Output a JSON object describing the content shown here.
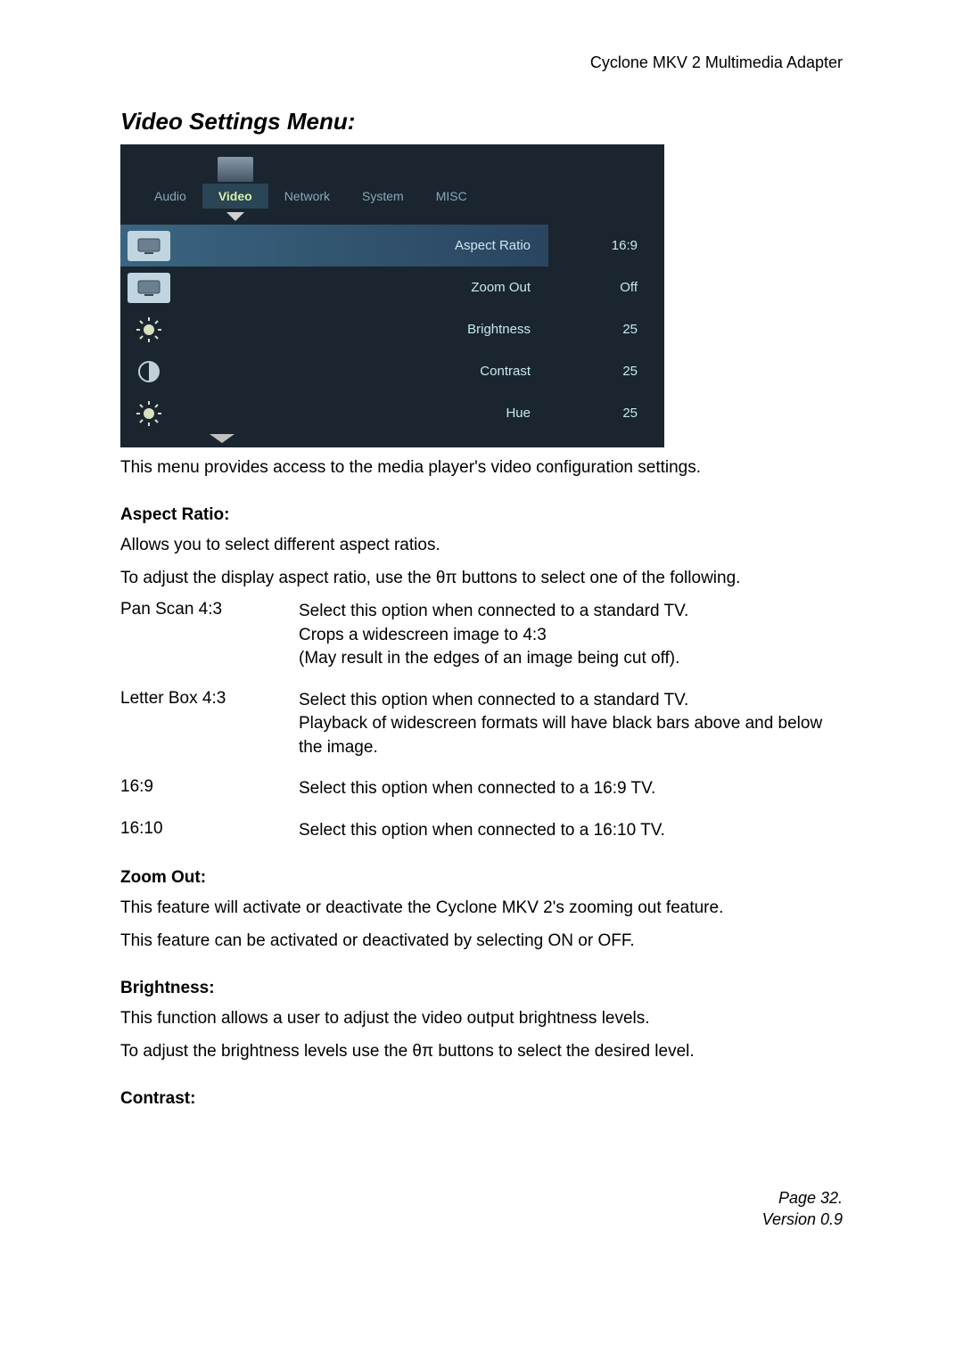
{
  "header": {
    "product": "Cyclone MKV 2 Multimedia Adapter"
  },
  "section_title": "Video Settings Menu:",
  "screenshot": {
    "tabs": [
      {
        "label": "Audio",
        "active": false
      },
      {
        "label": "Video",
        "active": true
      },
      {
        "label": "Network",
        "active": false
      },
      {
        "label": "System",
        "active": false
      },
      {
        "label": "MISC",
        "active": false
      }
    ],
    "settings": [
      {
        "label": "Aspect Ratio",
        "value": "16:9",
        "icon": "screen",
        "selected": true
      },
      {
        "label": "Zoom Out",
        "value": "Off",
        "icon": "screen",
        "selected": false
      },
      {
        "label": "Brightness",
        "value": "25",
        "icon": "sun",
        "selected": false
      },
      {
        "label": "Contrast",
        "value": "25",
        "icon": "circle",
        "selected": false
      },
      {
        "label": "Hue",
        "value": "25",
        "icon": "sun",
        "selected": false
      }
    ]
  },
  "intro_text": "This menu provides access to the media player's video configuration settings.",
  "aspect_ratio": {
    "heading": "Aspect Ratio:",
    "p1": "Allows you to select different aspect ratios.",
    "p2": "To adjust the display aspect ratio, use the θπ buttons to select one of the following.",
    "options": [
      {
        "name": "Pan Scan 4:3",
        "lines": [
          "Select this option when connected to a standard TV.",
          "Crops a widescreen image to 4:3",
          "(May result in the edges of an image being cut off)."
        ]
      },
      {
        "name": "Letter Box 4:3",
        "lines": [
          "Select this option when connected to a standard TV.",
          "Playback of widescreen formats will have black bars above and below the image."
        ]
      },
      {
        "name": "16:9",
        "lines": [
          "Select this option when connected to a 16:9 TV."
        ]
      },
      {
        "name": "16:10",
        "lines": [
          "Select this option when connected to a 16:10 TV."
        ]
      }
    ]
  },
  "zoom_out": {
    "heading": "Zoom Out:",
    "p1": "This feature will activate or deactivate the Cyclone MKV 2's zooming out feature.",
    "p2": "This feature can be activated or deactivated by selecting ON or OFF."
  },
  "brightness": {
    "heading": "Brightness:",
    "p1": "This function allows a user to adjust the video output brightness levels.",
    "p2": "To adjust the brightness levels use the θπ buttons to select the desired level."
  },
  "contrast": {
    "heading": "Contrast:"
  },
  "footer": {
    "page": "Page 32.",
    "version": "Version 0.9"
  }
}
